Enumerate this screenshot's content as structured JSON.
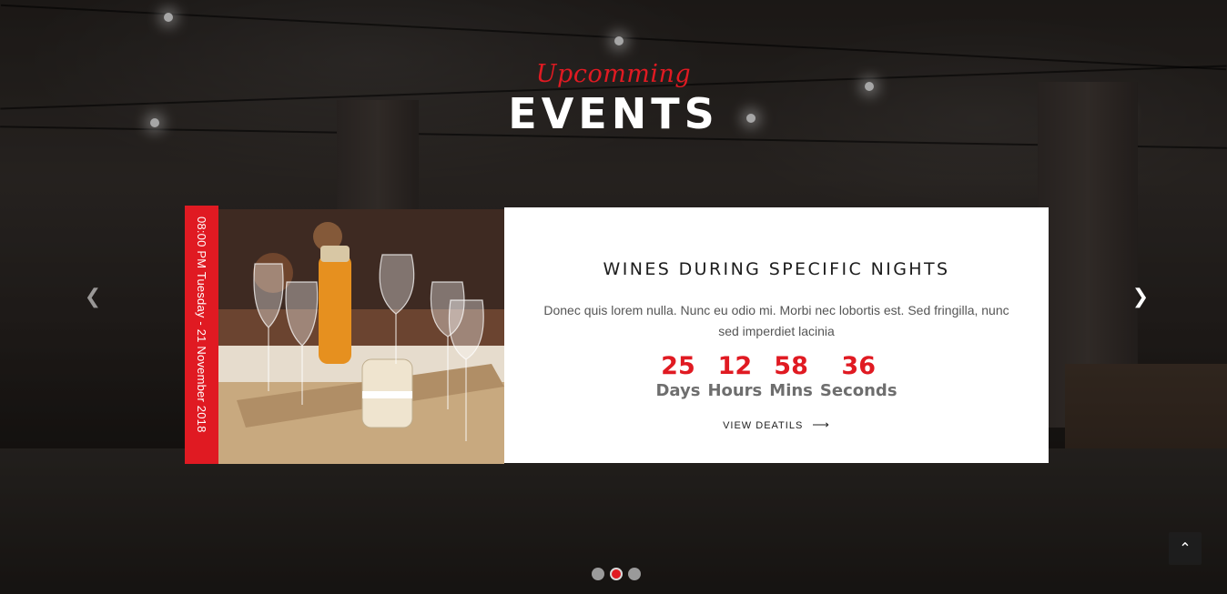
{
  "heading": {
    "script": "Upcomming",
    "title": "EVENTS"
  },
  "carousel": {
    "prev_icon": "chevron-left-icon",
    "next_icon": "chevron-right-icon",
    "dots": [
      {
        "active": false
      },
      {
        "active": true
      },
      {
        "active": false
      }
    ]
  },
  "event": {
    "date": "08:00 PM Tuesday - 21 November 2018",
    "title": "WINES DURING SPECIFIC NIGHTS",
    "description": "Donec quis lorem nulla. Nunc eu odio mi. Morbi nec lobortis est. Sed fringilla, nunc sed imperdiet lacinia",
    "countdown": [
      {
        "value": "25",
        "label": "Days"
      },
      {
        "value": "12",
        "label": "Hours"
      },
      {
        "value": "58",
        "label": "Mins"
      },
      {
        "value": "36",
        "label": "Seconds"
      }
    ],
    "link_label": "VIEW DEATILS",
    "link_icon": "long-arrow-right-icon"
  },
  "back_to_top_icon": "double-chevron-up-icon",
  "colors": {
    "accent": "#e01a22",
    "panel": "#ffffff"
  }
}
